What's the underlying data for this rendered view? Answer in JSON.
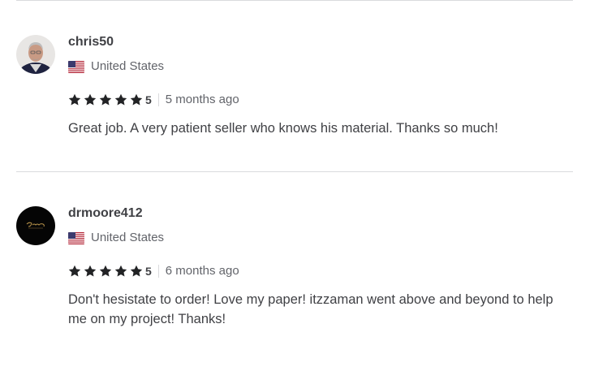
{
  "reviews": [
    {
      "username": "chris50",
      "country": "United States",
      "flag_icon": "us-flag-icon",
      "rating": "5",
      "stars": 5,
      "time_ago": "5 months ago",
      "text": "Great job. A very patient seller who knows his material. Thanks so much!"
    },
    {
      "username": "drmoore412",
      "country": "United States",
      "flag_icon": "us-flag-icon",
      "rating": "5",
      "stars": 5,
      "time_ago": "6 months ago",
      "text": "Don't hesistate to order! Love my paper! itzzaman went above and beyond to help me on my project! Thanks!"
    }
  ],
  "colors": {
    "text_primary": "#404145",
    "text_secondary": "#62646a",
    "star": "#222325",
    "divider": "#dadbdd"
  }
}
